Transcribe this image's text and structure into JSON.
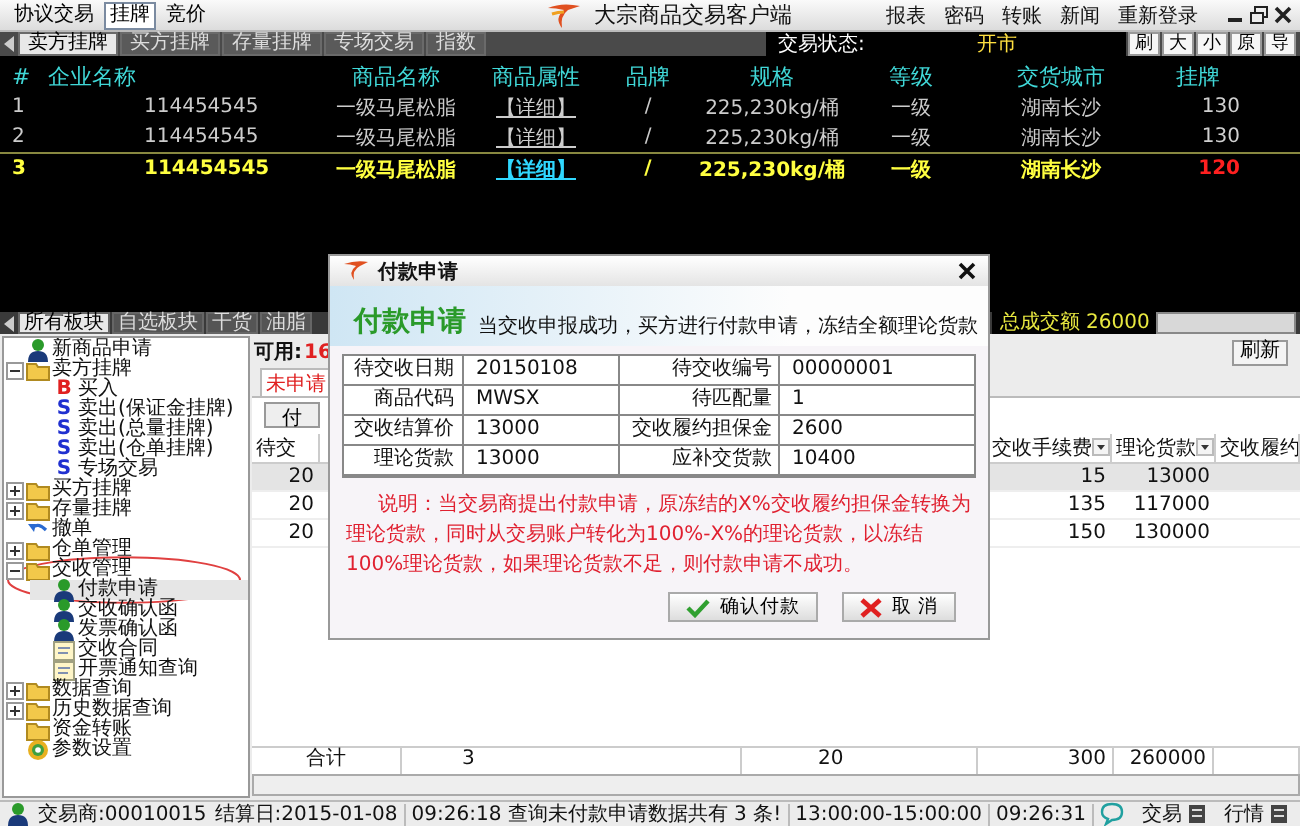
{
  "window": {
    "title": "大宗商品交易客户端",
    "mode_tabs": [
      {
        "label": "协议交易",
        "selected": false
      },
      {
        "label": "挂牌",
        "selected": true
      },
      {
        "label": "竞价",
        "selected": false
      }
    ],
    "menu": [
      "报表",
      "密码",
      "转账",
      "新闻",
      "重新登录"
    ]
  },
  "listing_tabs": [
    {
      "label": "卖方挂牌",
      "selected": true
    },
    {
      "label": "买方挂牌",
      "selected": false
    },
    {
      "label": "存量挂牌",
      "selected": false
    },
    {
      "label": "专场交易",
      "selected": false
    },
    {
      "label": "指数",
      "selected": false
    }
  ],
  "trade_status": {
    "label": "交易状态:",
    "value": "开市"
  },
  "view_buttons": [
    "刷",
    "大",
    "小",
    "原",
    "导"
  ],
  "market_table": {
    "columns": [
      "#",
      "企业名称",
      "商品名称",
      "商品属性",
      "品牌",
      "规格",
      "等级",
      "交货城市",
      "挂牌"
    ],
    "rows": [
      {
        "selected": false,
        "color": "#d0d0d0",
        "cells": [
          "1",
          "114454545",
          "一级马尾松脂",
          "【详细】",
          "/",
          "225,230kg/桶",
          "一级",
          "湖南长沙",
          "130"
        ]
      },
      {
        "selected": false,
        "color": "#d0d0d0",
        "cells": [
          "2",
          "114454545",
          "一级马尾松脂",
          "【详细】",
          "/",
          "225,230kg/桶",
          "一级",
          "湖南长沙",
          "130"
        ]
      },
      {
        "selected": true,
        "color": "#ff2020",
        "cells": [
          "3",
          "114454545",
          "一级马尾松脂",
          "【详细】",
          "/",
          "225,230kg/桶",
          "一级",
          "湖南长沙",
          "120"
        ]
      }
    ]
  },
  "board_tabs": [
    {
      "label": "所有板块",
      "selected": true
    },
    {
      "label": "自选板块",
      "selected": false
    },
    {
      "label": "干货",
      "selected": false
    },
    {
      "label": "油脂",
      "selected": false
    }
  ],
  "total": {
    "label": "总成交额",
    "value": "26000"
  },
  "tree": [
    {
      "label": "新商品申请",
      "kind": "user",
      "selected": false
    },
    {
      "label": "卖方挂牌",
      "kind": "folder",
      "selected": false,
      "expanded": true,
      "children": [
        {
          "label": "买入",
          "kind": "buy",
          "letter": "B",
          "selected": false
        },
        {
          "label": "卖出(保证金挂牌)",
          "kind": "sell",
          "letter": "S",
          "selected": false
        },
        {
          "label": "卖出(总量挂牌)",
          "kind": "sell",
          "letter": "S",
          "selected": false
        },
        {
          "label": "卖出(仓单挂牌)",
          "kind": "sell",
          "letter": "S",
          "selected": false
        },
        {
          "label": "专场交易",
          "kind": "sell",
          "letter": "S",
          "selected": false
        }
      ]
    },
    {
      "label": "买方挂牌",
      "kind": "folder",
      "selected": false,
      "expanded": false
    },
    {
      "label": "存量挂牌",
      "kind": "folder",
      "selected": false,
      "expanded": false
    },
    {
      "label": "撤单",
      "kind": "undo",
      "selected": false
    },
    {
      "label": "仓单管理",
      "kind": "folder",
      "selected": false,
      "expanded": false
    },
    {
      "label": "交收管理",
      "kind": "folder",
      "selected": false,
      "expanded": true,
      "children": [
        {
          "label": "付款申请",
          "kind": "user",
          "selected": true
        },
        {
          "label": "交收确认函",
          "kind": "user",
          "selected": false
        },
        {
          "label": "发票确认函",
          "kind": "user",
          "selected": false
        },
        {
          "label": "交收合同",
          "kind": "document",
          "selected": false
        },
        {
          "label": "开票通知查询",
          "kind": "document",
          "selected": false
        }
      ]
    },
    {
      "label": "数据查询",
      "kind": "folder",
      "selected": false,
      "expanded": false
    },
    {
      "label": "历史数据查询",
      "kind": "folder",
      "selected": false,
      "expanded": false
    },
    {
      "label": "资金转账",
      "kind": "folder",
      "selected": false
    },
    {
      "label": "参数设置",
      "kind": "gear",
      "selected": false
    }
  ],
  "panel": {
    "available_label": "可用:",
    "available_value": "16",
    "refresh": "刷新",
    "tabs": [
      {
        "label": "未申请",
        "selected": true
      }
    ],
    "action_button": "付",
    "table": {
      "columns": [
        "待交",
        "交收手续费",
        "理论货款",
        "交收履约"
      ],
      "rows": [
        {
          "selected": true,
          "cells": [
            "20",
            "15",
            "13000"
          ]
        },
        {
          "selected": false,
          "cells": [
            "20",
            "135",
            "117000"
          ]
        },
        {
          "selected": false,
          "cells": [
            "20",
            "150",
            "130000"
          ]
        }
      ],
      "totals": [
        "合计",
        "3",
        "20",
        "300",
        "260000"
      ]
    }
  },
  "dialog": {
    "title": "付款申请",
    "heading": "付款申请",
    "subtitle": "当交收申报成功，买方进行付款申请，冻结全额理论货款",
    "fields": [
      [
        "待交收日期",
        "20150108",
        "待交收编号",
        "00000001"
      ],
      [
        "商品代码",
        "MWSX",
        "待匹配量",
        "1"
      ],
      [
        "交收结算价",
        "13000",
        "交收履约担保金",
        "2600"
      ],
      [
        "理论货款",
        "13000",
        "应补交货款",
        "10400"
      ]
    ],
    "note": "说明：当交易商提出付款申请，原冻结的X%交收履约担保金转换为理论货款，同时从交易账户转化为100%-X%的理论货款，以冻结100%理论货款，如果理论货款不足，则付款申请不成功。",
    "buttons": [
      {
        "label": "确认付款",
        "kind": "confirm"
      },
      {
        "label": "取 消",
        "kind": "cancel"
      }
    ]
  },
  "status_bar": {
    "trader": "交易商:00010015",
    "settle_date": "结算日:2015-01-08",
    "message": "09:26:18 查询未付款申请数据共有 3 条!",
    "session": "13:00:00-15:00:00",
    "time": "09:26:31",
    "links": [
      "交易",
      "行情"
    ]
  }
}
